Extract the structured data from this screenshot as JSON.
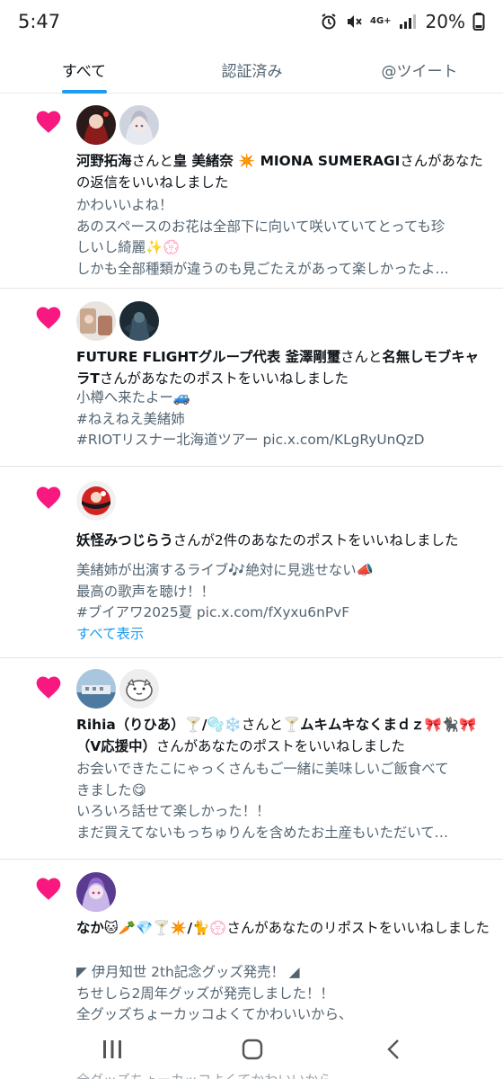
{
  "status_bar": {
    "time": "5:47",
    "network": "4G+",
    "battery": "20%"
  },
  "tabs": [
    {
      "label": "すべて",
      "active": true
    },
    {
      "label": "認証済み",
      "active": false
    },
    {
      "label": "@ツイート",
      "active": false
    }
  ],
  "notifications": [
    {
      "user1": "河野拓海",
      "joiner1": "さんと",
      "user2": "皇 美緒奈 ✴️ MIONA SUMERAGI",
      "action": "さんがあなたの返信をいいねしました",
      "preview": [
        "かわいいよね！",
        "あのスペースのお花は全部下に向いて咲いていてとっても珍",
        "しいし綺麗✨💮",
        "しかも全部種類が違うのも見ごたえがあって楽しかったよ…"
      ]
    },
    {
      "user1": "FUTURE FLIGHTグループ代表 釜澤剛璽",
      "joiner1": "さんと",
      "user2": "名無しモブキャラT",
      "action": "さんがあなたのポストをいいねしました",
      "preview": [
        "小樽へ来たよー🚙",
        "#ねえねえ美緒姉",
        "#RIOTリスナー北海道ツアー pic.x.com/KLgRyUnQzD"
      ]
    },
    {
      "user1": "妖怪みつじらう",
      "action": "さんが2件のあなたのポストをいいねしました",
      "preview": [
        "美緒姉が出演するライブ🎶絶対に見逃せない📣",
        "最高の歌声を聴け！！",
        "#ブイアワ2025夏 pic.x.com/fXyxu6nPvF"
      ],
      "show_all": "すべて表示"
    },
    {
      "user1": "Rihia（りひあ）🍸/🫧❄️",
      "joiner1": "さんと",
      "user2": "🍸ムキムキなくまｄｚ🎀🐈‍⬛🎀（V応援中）",
      "action": "さんがあなたのポストをいいねしました",
      "preview": [
        "お会いできたこにゃっくさんもご一緒に美味しいご飯食べて",
        "きました😋",
        "いろいろ話せて楽しかった！！",
        "まだ買えてないもっちゅりんを含めたお土産もいただいて…"
      ]
    },
    {
      "user1": "なか🐱🥕💎🍸✴️/🐈💮",
      "action": "さんがあなたのリポストをいいねしました",
      "preview": [
        "◤ 伊月知世 2th記念グッズ発売！ ◢",
        "ちせしら2周年グッズが発売しました！！",
        "全グッズちょーカッコよくてかわいいから、"
      ]
    }
  ],
  "overflow_text": "全グッズちょーカッコよくてかわいいから",
  "nav": {
    "recents_icon": "recents-icon",
    "home_icon": "home-icon",
    "back_icon": "back-icon"
  },
  "colors": {
    "heart": "#f91880",
    "accent": "#1d9bf0",
    "secondary_text": "#536471"
  }
}
